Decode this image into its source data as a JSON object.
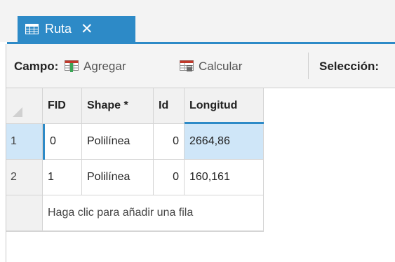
{
  "tab": {
    "title": "Ruta",
    "close": "✕"
  },
  "toolbar": {
    "field_label": "Campo:",
    "add_label": "Agregar",
    "calculate_label": "Calcular",
    "selection_label": "Selección:"
  },
  "table": {
    "columns": [
      "FID",
      "Shape *",
      "Id",
      "Longitud"
    ],
    "rows": [
      {
        "row_number": "1",
        "FID": "0",
        "Shape": "Polilínea",
        "Id": "0",
        "Longitud": "2664,86"
      },
      {
        "row_number": "2",
        "FID": "1",
        "Shape": "Polilínea",
        "Id": "0",
        "Longitud": "160,161"
      }
    ],
    "add_row_text": "Haga clic para añadir una fila"
  },
  "colors": {
    "accent": "#2d8ac7",
    "selected_cell": "#cfe6f8",
    "header_bg": "#f1f1f1"
  }
}
